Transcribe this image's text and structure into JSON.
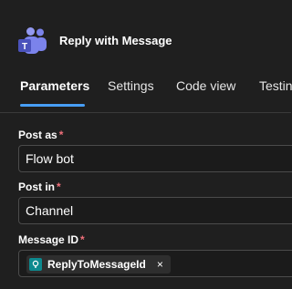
{
  "header": {
    "title": "Reply with Message",
    "app_icon": "teams-icon"
  },
  "tabs": [
    {
      "label": "Parameters",
      "active": true
    },
    {
      "label": "Settings",
      "active": false
    },
    {
      "label": "Code view",
      "active": false
    },
    {
      "label": "Testing",
      "active": false
    }
  ],
  "fields": {
    "post_as": {
      "label": "Post as",
      "required_mark": "*",
      "value": "Flow bot"
    },
    "post_in": {
      "label": "Post in",
      "required_mark": "*",
      "value": "Channel"
    },
    "message_id": {
      "label": "Message ID",
      "required_mark": "*",
      "token": {
        "label": "ReplyToMessageId",
        "icon": "expression-icon",
        "remove": "×"
      }
    }
  },
  "colors": {
    "background": "#1f1f1f",
    "accent": "#479ef5",
    "required": "#f1707b",
    "token_icon": "#0d8a8f",
    "teams_purple": "#5b5fc7"
  }
}
